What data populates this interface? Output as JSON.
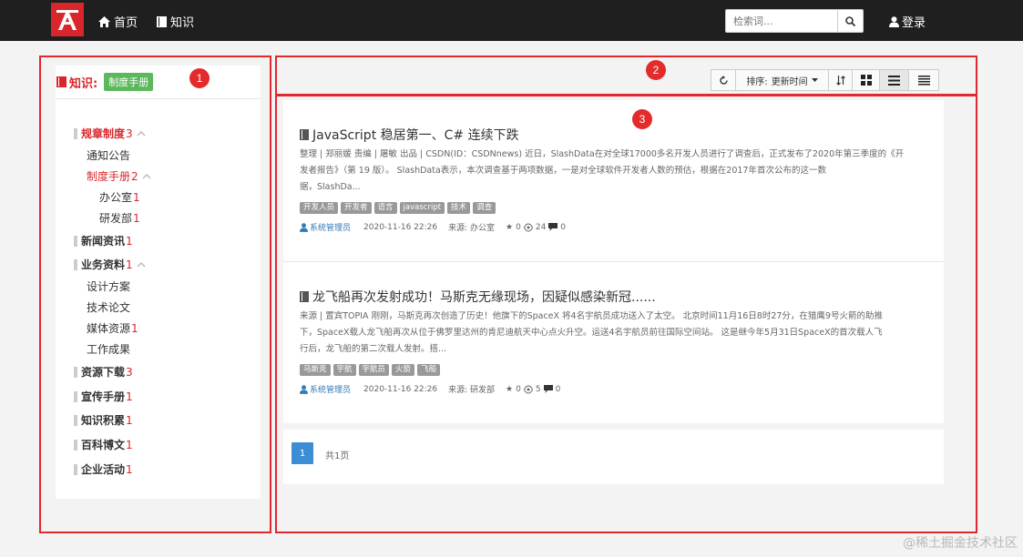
{
  "header": {
    "nav": [
      {
        "label": "首页",
        "icon": "home-icon"
      },
      {
        "label": "知识",
        "icon": "book-icon"
      }
    ],
    "search_placeholder": "检索词...",
    "login_label": "登录"
  },
  "markers": [
    "1",
    "2",
    "3"
  ],
  "sidebar": {
    "title": "知识:",
    "badge": "制度手册",
    "items": [
      {
        "label": "规章制度",
        "count": "3",
        "level": 0,
        "expanded": true,
        "active": true
      },
      {
        "label": "通知公告",
        "count": "",
        "level": 1
      },
      {
        "label": "制度手册",
        "count": "2",
        "level": 1,
        "expanded": true,
        "active": true
      },
      {
        "label": "办公室",
        "count": "1",
        "level": 2
      },
      {
        "label": "研发部",
        "count": "1",
        "level": 2
      },
      {
        "label": "新闻资讯",
        "count": "1",
        "level": 0
      },
      {
        "label": "业务资料",
        "count": "1",
        "level": 0,
        "expanded": true
      },
      {
        "label": "设计方案",
        "count": "",
        "level": 1
      },
      {
        "label": "技术论文",
        "count": "",
        "level": 1
      },
      {
        "label": "媒体资源",
        "count": "1",
        "level": 1
      },
      {
        "label": "工作成果",
        "count": "",
        "level": 1
      },
      {
        "label": "资源下载",
        "count": "3",
        "level": 0
      },
      {
        "label": "宣传手册",
        "count": "1",
        "level": 0
      },
      {
        "label": "知识积累",
        "count": "1",
        "level": 0
      },
      {
        "label": "百科博文",
        "count": "1",
        "level": 0
      },
      {
        "label": "企业活动",
        "count": "1",
        "level": 0
      }
    ]
  },
  "toolbar": {
    "sort_label": "排序:",
    "sort_value": "更新时间"
  },
  "articles": [
    {
      "title": "JavaScript 稳居第一、C# 连续下跌",
      "body_line1": "整理 | 郑丽媛 责编 | 屠敏 出品 | CSDN(ID：CSDNnews) 近日，SlashData在对全球17000多名开发人员进行了调查后，正式发布了2020年第三季度的《开",
      "body_line2": "发者报告》（第 19 版）。 SlashData表示，本次调查基于两项数据，一是对全球软件开发者人数的预估，根据在2017年首次公布的这一数",
      "body_line3": "据，SlashDa...",
      "tags": [
        "开发人员",
        "开发者",
        "语言",
        "javascript",
        "技术",
        "调查"
      ],
      "author": "系统管理员",
      "date": "2020-11-16 22:26",
      "source": "来源: 办公室",
      "stars": "0",
      "views": "24",
      "comments": "0"
    },
    {
      "title": "龙飞船再次发射成功！马斯克无缘现场，因疑似感染新冠......",
      "body_line1": "来源 | 置宾TOPIA 刚刚，马斯克再次创造了历史！他旗下的SpaceX 将4名宇航员成功送入了太空。 北京时间11月16日8时27分，在猎鹰9号火箭的助推",
      "body_line2": "下，SpaceX载人龙飞船再次从位于佛罗里达州的肯尼迪航天中心点火升空。运送4名宇航员前往国际空间站。 这是继今年5月31日SpaceX的首次载人飞",
      "body_line3": "行后，龙飞船的第二次载人发射。搭...",
      "tags": [
        "马斯克",
        "宇航",
        "宇航员",
        "火箭",
        "飞船"
      ],
      "author": "系统管理员",
      "date": "2020-11-16 22:26",
      "source": "来源: 研发部",
      "stars": "0",
      "views": "5",
      "comments": "0"
    }
  ],
  "pagination": {
    "current": "1",
    "total": "共1页"
  },
  "watermark": "@稀土掘金技术社区"
}
